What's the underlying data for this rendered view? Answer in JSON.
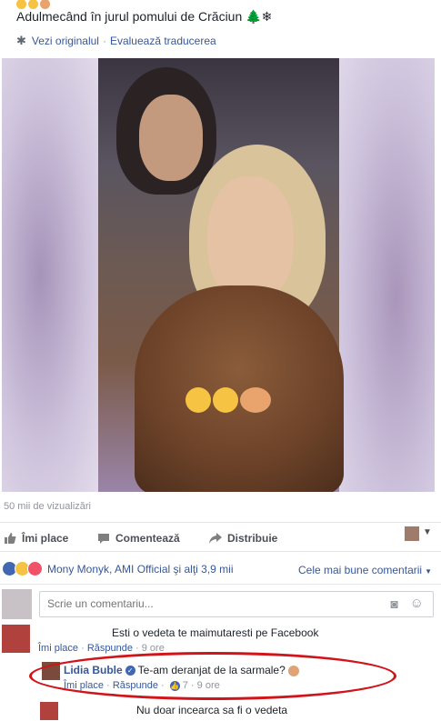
{
  "post": {
    "caption": "Adulmecând în jurul pomului de Crăciun 🌲❄",
    "see_original": "Vezi originalul",
    "separator": "·",
    "rate_translation": "Evaluează traducerea",
    "views": "50 mii de vizualizări"
  },
  "video": {
    "overlay_emoji": "😂😂👫"
  },
  "actions": {
    "like": "Îmi place",
    "comment": "Comentează",
    "share": "Distribuie"
  },
  "reactions": {
    "summary": "Mony Monyk, AMI Official şi alţi 3,9 mii",
    "sort": "Cele mai bune comentarii"
  },
  "comment_input": {
    "placeholder": "Scrie un comentariu..."
  },
  "comments": [
    {
      "text": "Esti o vedeta te maimutaresti pe Facebook",
      "like": "Îmi place",
      "reply": "Răspunde",
      "time": "9 ore"
    },
    {
      "author": "Lidia Buble",
      "text": "Te-am deranjat de la sarmale?",
      "like": "Îmi place",
      "reply": "Răspunde",
      "likes": "7",
      "time": "9 ore"
    },
    {
      "text": "Nu doar incearca sa fi o vedeta"
    }
  ],
  "colors": {
    "link": "#365899",
    "highlight": "#d0141a",
    "muted": "#90949c"
  }
}
